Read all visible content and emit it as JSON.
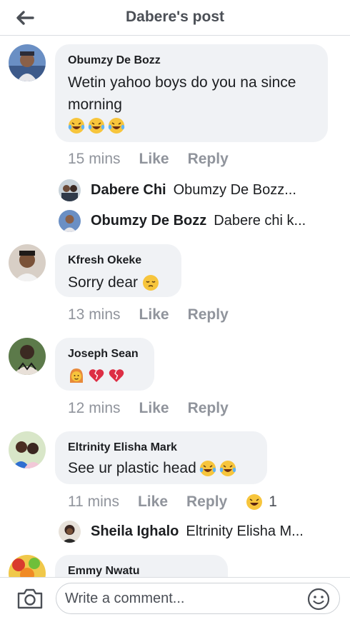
{
  "header": {
    "title": "Dabere's post"
  },
  "comments": [
    {
      "name": "Obumzy De Bozz",
      "text": "Wetin yahoo boys do you na since morning",
      "emojis": [
        "laughing-tears",
        "laughing-tears",
        "laughing-tears"
      ],
      "time": "15 mins",
      "like": "Like",
      "reply": "Reply",
      "replies": [
        {
          "name": "Dabere Chi",
          "text": "Obumzy De Bozz..."
        },
        {
          "name": "Obumzy De Bozz",
          "text": "Dabere chi k..."
        }
      ]
    },
    {
      "name": "Kfresh Okeke",
      "text": "Sorry dear",
      "emojis": [
        "pensive-face"
      ],
      "time": "13 mins",
      "like": "Like",
      "reply": "Reply"
    },
    {
      "name": "Joseph Sean",
      "text": "",
      "emojis": [
        "woman-face",
        "broken-heart",
        "broken-heart"
      ],
      "time": "12 mins",
      "like": "Like",
      "reply": "Reply"
    },
    {
      "name": "Eltrinity Elisha Mark",
      "text": "See ur plastic head",
      "emojis": [
        "laughing-tears",
        "laughing-tears"
      ],
      "time": "11 mins",
      "like": "Like",
      "reply": "Reply",
      "reaction": {
        "icon": "haha-reaction",
        "count": "1"
      },
      "replies": [
        {
          "name": "Sheila Ighalo",
          "text": "Eltrinity Elisha M..."
        }
      ]
    },
    {
      "name": "Emmy Nwatu"
    }
  ],
  "composer": {
    "placeholder": "Write a comment...",
    "camera_icon": "camera-icon",
    "emoji_icon": "smiley-icon"
  }
}
